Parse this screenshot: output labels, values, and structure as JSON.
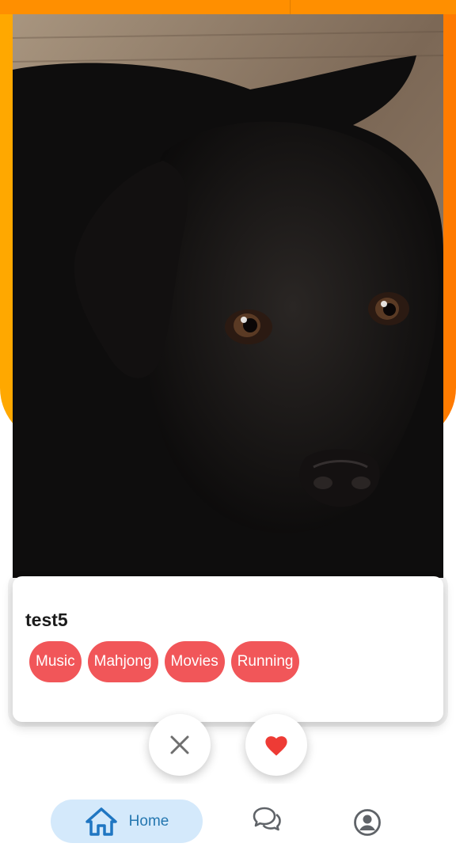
{
  "profile": {
    "name": "test5",
    "photo_subject": "black labrador puppy",
    "interests": [
      "Music",
      "Mahjong",
      "Movies",
      "Running"
    ]
  },
  "actions": {
    "dislike_icon": "close-icon",
    "like_icon": "heart-icon"
  },
  "nav": {
    "home_label": "Home",
    "home_icon": "home-icon",
    "chat_icon": "chat-bubbles-icon",
    "profile_icon": "account-circle-icon"
  },
  "colors": {
    "header_orange": "#ff9a00",
    "tag_red": "#f15659",
    "heart_red": "#ee3b35",
    "nav_active_bg": "#d4e9fb",
    "nav_active_fg": "#2577b0"
  }
}
